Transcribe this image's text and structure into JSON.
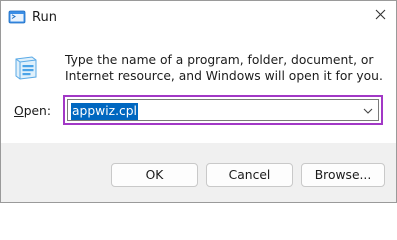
{
  "window": {
    "title": "Run",
    "app_icon": "run-icon",
    "close_icon": "close-icon"
  },
  "prompt": {
    "description": "Type the name of a program, folder, document, or Internet resource, and Windows will open it for you."
  },
  "open_field": {
    "label_prefix": "",
    "label_accel": "O",
    "label_rest": "pen:",
    "value": "appwiz.cpl",
    "dropdown_icon": "chevron-down-icon",
    "highlight_color": "#a238c6",
    "selection_color": "#0067c0"
  },
  "buttons": {
    "ok": "OK",
    "cancel": "Cancel",
    "browse": "Browse..."
  }
}
